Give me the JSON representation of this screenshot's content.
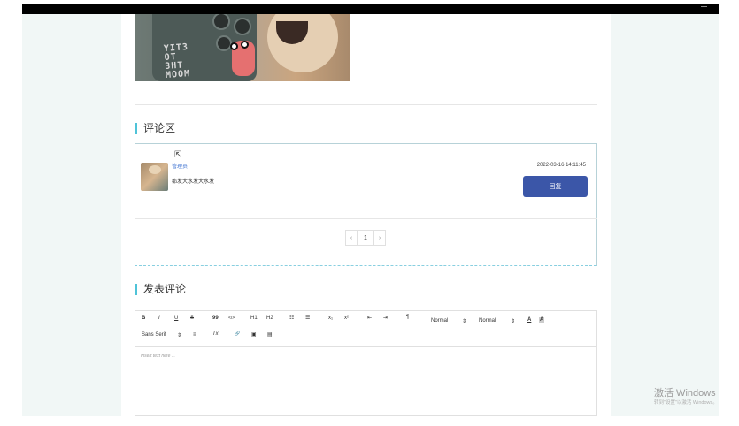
{
  "comments_section": {
    "title": "评论区",
    "comments": [
      {
        "username": "管理员",
        "text": "都发大水发大水发",
        "time": "2022-03-16 14:11:45",
        "reply_label": "回复"
      }
    ],
    "pagination": {
      "prev": "‹",
      "current": "1",
      "next": "›"
    }
  },
  "post_comment": {
    "title": "发表评论",
    "toolbar": {
      "bold": "B",
      "italic": "I",
      "underline": "U",
      "strike": "S",
      "blockquote": "99",
      "code": "</>",
      "h1": "H1",
      "h2": "H2",
      "ordered_list": "☷",
      "bullet_list": "☰",
      "subscript": "x₁",
      "superscript": "x²",
      "indent_out": "⇤",
      "indent_in": "⇥",
      "direction": "¶",
      "size_select": "Normal",
      "header_select": "Normal",
      "font_color": "A",
      "background_color": "A",
      "font_select": "Sans Serif",
      "align": "≡",
      "clean": "Tx",
      "link": "🔗",
      "image": "▣",
      "video": "▤"
    },
    "placeholder": "Insert text here ..."
  },
  "watermark": {
    "title": "激活 Windows",
    "subtitle": "转到\"设置\"以激活 Windows。"
  },
  "colors": {
    "accent": "#4fc3d8",
    "reply_button": "#3b56a8",
    "username": "#3a6fd0"
  }
}
